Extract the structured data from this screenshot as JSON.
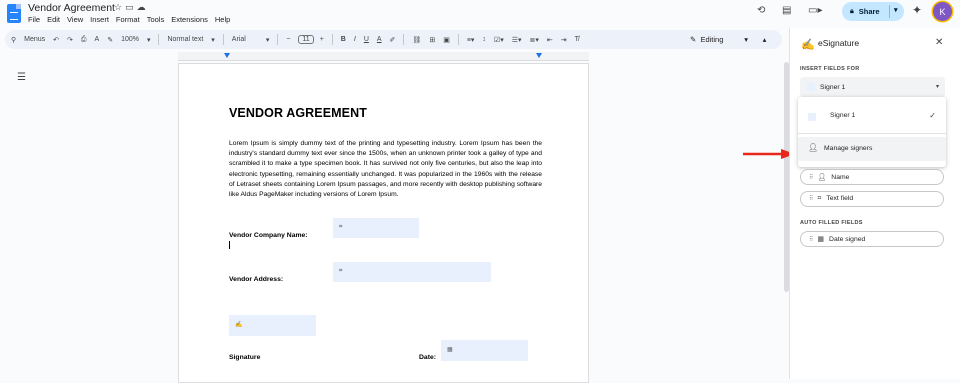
{
  "app": {
    "doc_title": "Vendor Agreement",
    "menu": [
      "File",
      "Edit",
      "View",
      "Insert",
      "Format",
      "Tools",
      "Extensions",
      "Help"
    ],
    "share_label": "Share",
    "avatar_initial": "K"
  },
  "toolbar": {
    "menus_label": "Menus",
    "zoom": "100%",
    "style": "Normal text",
    "font": "Arial",
    "font_size": "11",
    "mode": "Editing"
  },
  "document": {
    "heading": "VENDOR AGREEMENT",
    "body": "Lorem Ipsum is simply dummy text of the printing and typesetting industry. Lorem Ipsum has been the industry's standard dummy text ever since the 1500s, when an unknown printer took a galley of type and scrambled it to make a type specimen book. It has survived not only five centuries, but also the leap into electronic typesetting, remaining essentially unchanged. It was popularized in the 1960s with the release of Letraset sheets containing Lorem Ipsum passages, and more recently with desktop publishing software like Aldus PageMaker including versions of Lorem Ipsum.",
    "label_company": "Vendor Company Name:",
    "label_address": "Vendor Address:",
    "label_signature": "Signature",
    "label_date": "Date:"
  },
  "panel": {
    "title": "eSignature",
    "insert_fields_for": "INSERT FIELDS FOR",
    "selected_signer": "Signer 1",
    "dropdown_signer": "Signer 1",
    "manage_signers": "Manage signers",
    "fields": [
      "Name",
      "Text field"
    ],
    "auto_filled_label": "AUTO FILLED FIELDS",
    "auto_fields": [
      "Date signed"
    ]
  },
  "colors": {
    "accent": "#1a73e8",
    "field_fill": "#e8f0fe",
    "share_bg": "#c2e7ff",
    "arrow": "#e8261a"
  }
}
